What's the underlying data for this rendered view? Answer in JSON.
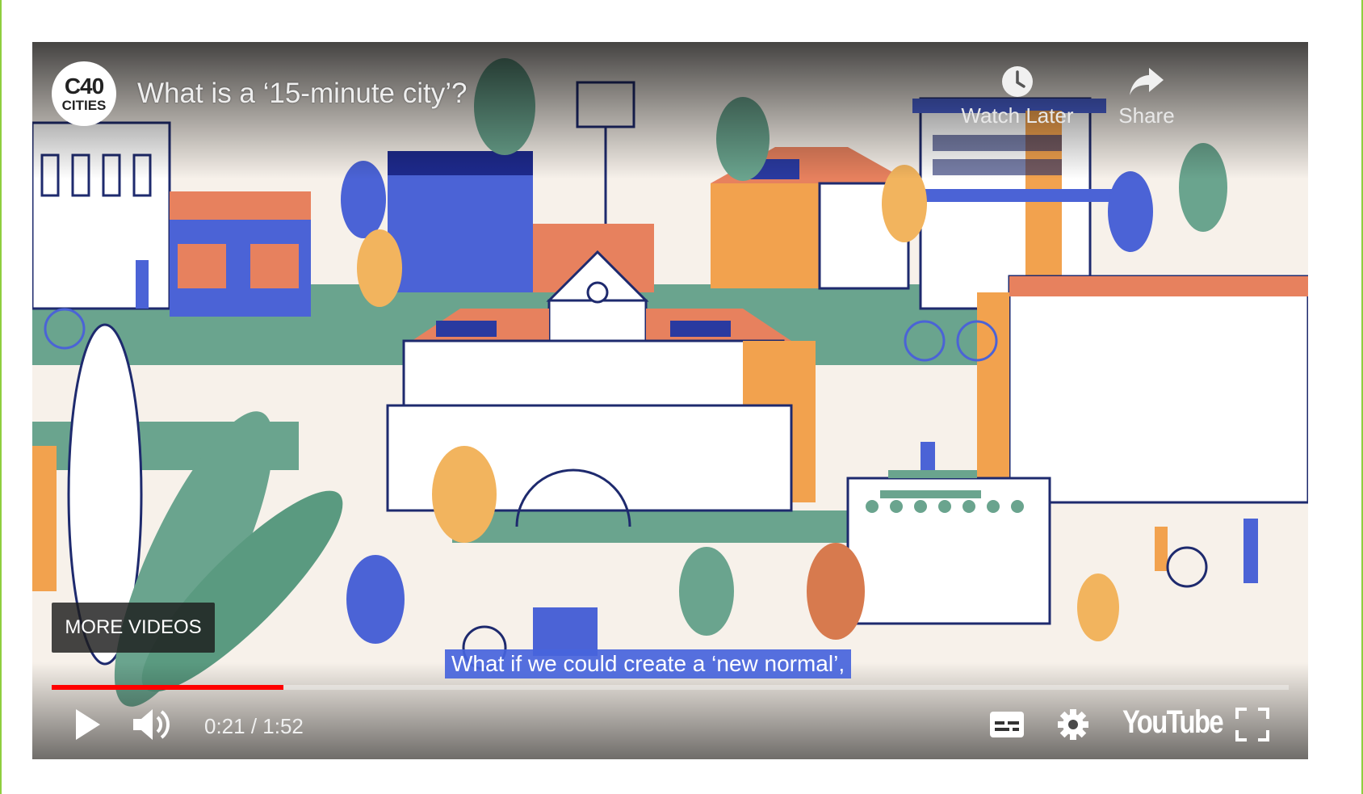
{
  "video": {
    "title": "What is a ‘15-minute city’?",
    "channel_logo": {
      "line1": "C40",
      "line2": "CITIES"
    },
    "actions": {
      "watch_later": "Watch Later",
      "share": "Share"
    },
    "more_videos_label": "MORE VIDEOS",
    "caption": "What if we could create a ‘new normal’,",
    "progress_fraction": 0.1875,
    "time_display": "0:21 / 1:52",
    "brand": "YouTube",
    "icons": {
      "watch_later": "clock-icon",
      "share": "share-arrow-icon",
      "play": "play-icon",
      "volume": "volume-icon",
      "captions": "captions-icon",
      "settings": "gear-icon",
      "fullscreen": "fullscreen-icon"
    },
    "colors": {
      "progress": "#ff0000",
      "caption_bg": "#4664dc",
      "frame_border": "#8fce3f"
    }
  }
}
